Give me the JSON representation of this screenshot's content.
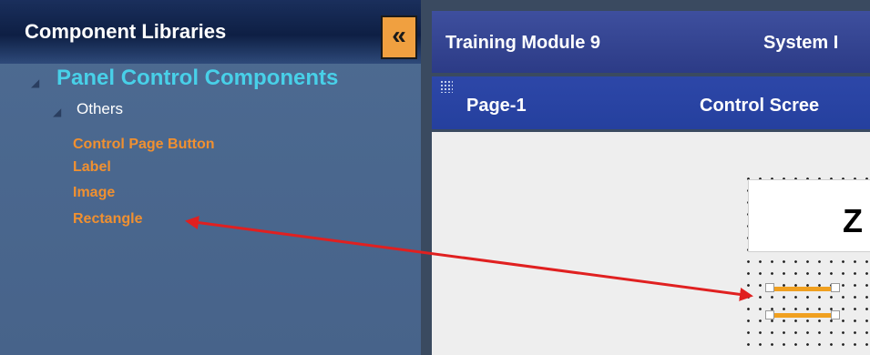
{
  "left_panel": {
    "title": "Component Libraries",
    "collapse_glyph": "«",
    "tree": {
      "root_label": "Panel Control Components",
      "group_label": "Others",
      "items": [
        "Control Page Button",
        "Label",
        "Image",
        "Rectangle"
      ]
    }
  },
  "right_panel": {
    "module_title": "Training Module 9",
    "system_title": "System I",
    "page_tab": "Page-1",
    "screen_title": "Control Scree",
    "label_text": "Z"
  },
  "colors": {
    "accent_orange": "#f09030",
    "tree_root": "#48d0e8",
    "arrow": "#e02020"
  }
}
